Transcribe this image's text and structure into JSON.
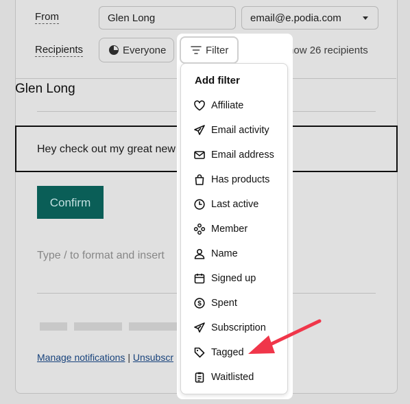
{
  "compose": {
    "from_label": "From",
    "sender_name": "Glen Long",
    "sender_email": "email@e.podia.com",
    "recipients_label": "Recipients",
    "everyone_label": "Everyone",
    "filter_label": "Filter",
    "show_recipients": "Show 26 recipients",
    "author": "Glen Long",
    "message_preview": "Hey check out my great new c",
    "confirm_label": "Confirm",
    "editor_placeholder": "Type / to format and insert",
    "manage_notifications": "Manage notifications",
    "unsubscribe": "Unsubscr"
  },
  "filter_menu": {
    "title": "Add filter",
    "items": [
      {
        "label": "Affiliate",
        "icon": "heart-icon"
      },
      {
        "label": "Email activity",
        "icon": "paper-plane-icon"
      },
      {
        "label": "Email address",
        "icon": "envelope-icon"
      },
      {
        "label": "Has products",
        "icon": "shopping-bag-icon"
      },
      {
        "label": "Last active",
        "icon": "clock-icon"
      },
      {
        "label": "Member",
        "icon": "community-icon"
      },
      {
        "label": "Name",
        "icon": "user-icon"
      },
      {
        "label": "Signed up",
        "icon": "calendar-icon"
      },
      {
        "label": "Spent",
        "icon": "dollar-icon"
      },
      {
        "label": "Subscription",
        "icon": "paper-plane-icon"
      },
      {
        "label": "Tagged",
        "icon": "tag-icon"
      },
      {
        "label": "Waitlisted",
        "icon": "clipboard-list-icon"
      }
    ]
  },
  "annotation": {
    "color": "#f0364a",
    "points_to": "Tagged"
  }
}
